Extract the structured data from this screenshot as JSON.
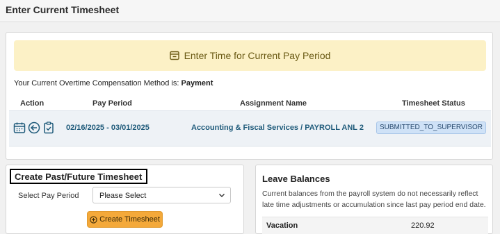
{
  "header": {
    "title": "Enter Current Timesheet"
  },
  "banner": {
    "text": "Enter Time for Current Pay Period",
    "icon": "calendar-box-icon"
  },
  "overtime": {
    "label": "Your Current Overtime Compensation Method is:",
    "value": "Payment"
  },
  "table": {
    "columns": [
      "Action",
      "Pay Period",
      "Assignment Name",
      "Timesheet Status"
    ],
    "rows": [
      {
        "actions": [
          "calendar-icon",
          "back-arrow-icon",
          "clipboard-check-icon"
        ],
        "pay_period": "02/16/2025 - 03/01/2025",
        "assignment": "Accounting & Fiscal Services / PAYROLL ANL 2",
        "status": "SUBMITTED_TO_SUPERVISOR"
      }
    ]
  },
  "create_panel": {
    "title": "Create Past/Future Timesheet",
    "pay_period_label": "Select Pay Period",
    "pay_period_value": "Please Select",
    "button_label": "Create Timesheet"
  },
  "leave_balances": {
    "title": "Leave Balances",
    "description": "Current balances from the payroll system do not necessarily reflect late time adjustments or accumulation since last pay period end date.",
    "rows": [
      {
        "name": "Vacation",
        "value": "220.92"
      }
    ]
  },
  "colors": {
    "banner_bg": "#fcf1c6",
    "link_blue": "#1e5a7a",
    "status_bg": "#cfe2f7",
    "button_orange": "#f4a93a"
  }
}
